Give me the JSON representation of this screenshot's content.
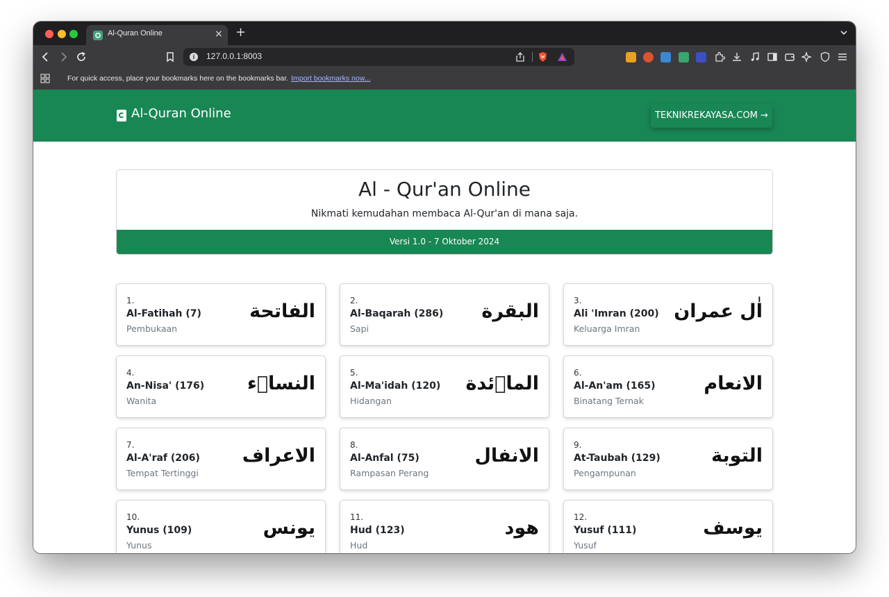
{
  "browser": {
    "tab_title": "Al-Quran Online",
    "url": "127.0.0.1:8003",
    "bookmarks_text": "For quick access, place your bookmarks here on the bookmarks bar.",
    "bookmarks_link": "Import bookmarks now..."
  },
  "navbar": {
    "brand": "Al-Quran Online",
    "link": "TEKNIKREKAYASA.COM →"
  },
  "hero": {
    "title": "Al - Qur'an Online",
    "subtitle": "Nikmati kemudahan membaca Al-Qur'an di mana saja.",
    "version": "Versi 1.0 - 7 Oktober 2024"
  },
  "surahs": [
    {
      "number": "1.",
      "name": "Al-Fatihah (7)",
      "meaning": "Pembukaan",
      "arabic": "الفاتحة"
    },
    {
      "number": "2.",
      "name": "Al-Baqarah (286)",
      "meaning": "Sapi",
      "arabic": "البقرة"
    },
    {
      "number": "3.",
      "name": "Ali 'Imran (200)",
      "meaning": "Keluarga Imran",
      "arabic": "اٰل عمران"
    },
    {
      "number": "4.",
      "name": "An-Nisa' (176)",
      "meaning": "Wanita",
      "arabic": "النساۤء"
    },
    {
      "number": "5.",
      "name": "Al-Ma'idah (120)",
      "meaning": "Hidangan",
      "arabic": "الماۤئدة"
    },
    {
      "number": "6.",
      "name": "Al-An'am (165)",
      "meaning": "Binatang Ternak",
      "arabic": "الانعام"
    },
    {
      "number": "7.",
      "name": "Al-A'raf (206)",
      "meaning": "Tempat Tertinggi",
      "arabic": "الاعراف"
    },
    {
      "number": "8.",
      "name": "Al-Anfal (75)",
      "meaning": "Rampasan Perang",
      "arabic": "الانفال"
    },
    {
      "number": "9.",
      "name": "At-Taubah (129)",
      "meaning": "Pengampunan",
      "arabic": "التوبة"
    },
    {
      "number": "10.",
      "name": "Yunus (109)",
      "meaning": "Yunus",
      "arabic": "يونس"
    },
    {
      "number": "11.",
      "name": "Hud (123)",
      "meaning": "Hud",
      "arabic": "هود"
    },
    {
      "number": "12.",
      "name": "Yusuf (111)",
      "meaning": "Yusuf",
      "arabic": "يوسف"
    }
  ],
  "colors": {
    "primary": "#198754",
    "browser_frame": "#3b3b3e",
    "tab_strip": "#1f1f22"
  }
}
